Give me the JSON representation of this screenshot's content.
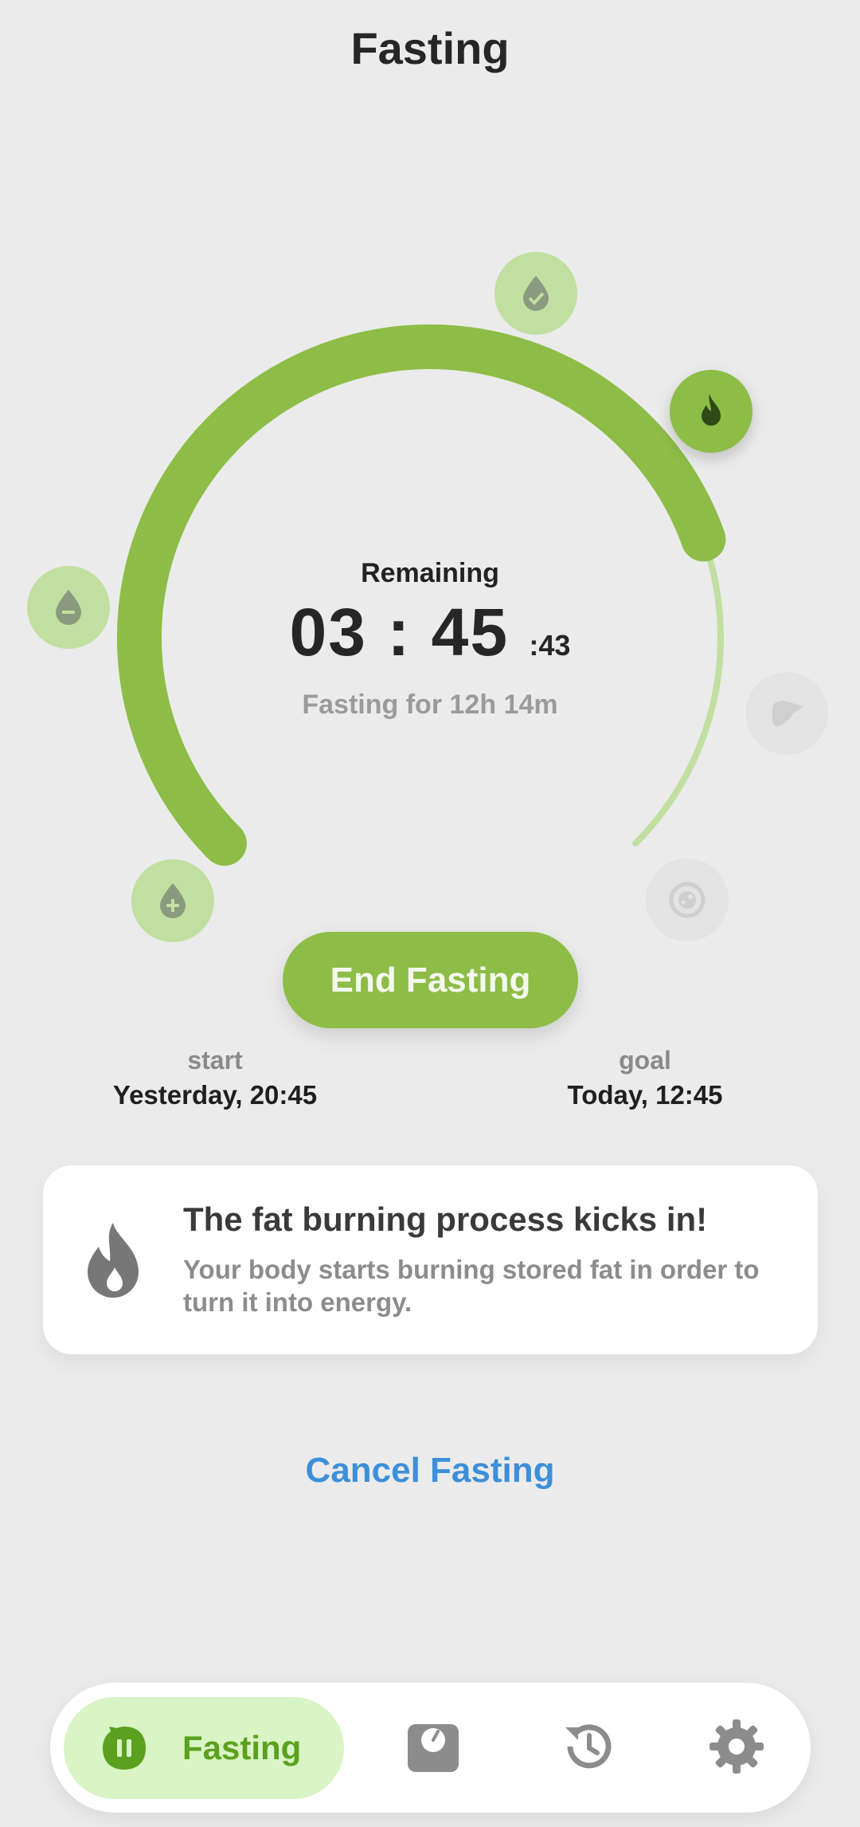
{
  "header": {
    "title": "Fasting"
  },
  "progress": {
    "fraction_elapsed": 0.76
  },
  "timer": {
    "label": "Remaining",
    "hours_minutes": "03 : 45",
    "seconds": ":43",
    "elapsed": "Fasting for 12h 14m"
  },
  "stages": [
    {
      "name": "sugar-rises",
      "icon": "drop-plus-icon",
      "state": "passed"
    },
    {
      "name": "sugar-drops",
      "icon": "drop-minus-icon",
      "state": "passed"
    },
    {
      "name": "sugar-normal",
      "icon": "drop-check-icon",
      "state": "passed"
    },
    {
      "name": "fat-burning",
      "icon": "flame-icon",
      "state": "active"
    },
    {
      "name": "ketosis",
      "icon": "liver-icon",
      "state": "locked"
    },
    {
      "name": "autophagy",
      "icon": "cell-icon",
      "state": "locked"
    }
  ],
  "actions": {
    "end_label": "End Fasting",
    "cancel_label": "Cancel Fasting"
  },
  "times": {
    "start_label": "start",
    "start_value": "Yesterday, 20:45",
    "goal_label": "goal",
    "goal_value": "Today, 12:45"
  },
  "info_card": {
    "icon": "flame-icon",
    "title": "The fat burning process kicks in!",
    "body": "Your body starts burning stored fat in order to turn it into energy."
  },
  "nav": {
    "active_label": "Fasting",
    "items": [
      "fasting-tab",
      "weight-tab",
      "history-tab",
      "settings-tab"
    ]
  },
  "colors": {
    "accent": "#8dbd47",
    "accent_light": "#c1dfa0",
    "link": "#3d8fd9",
    "background": "#ebebeb"
  }
}
